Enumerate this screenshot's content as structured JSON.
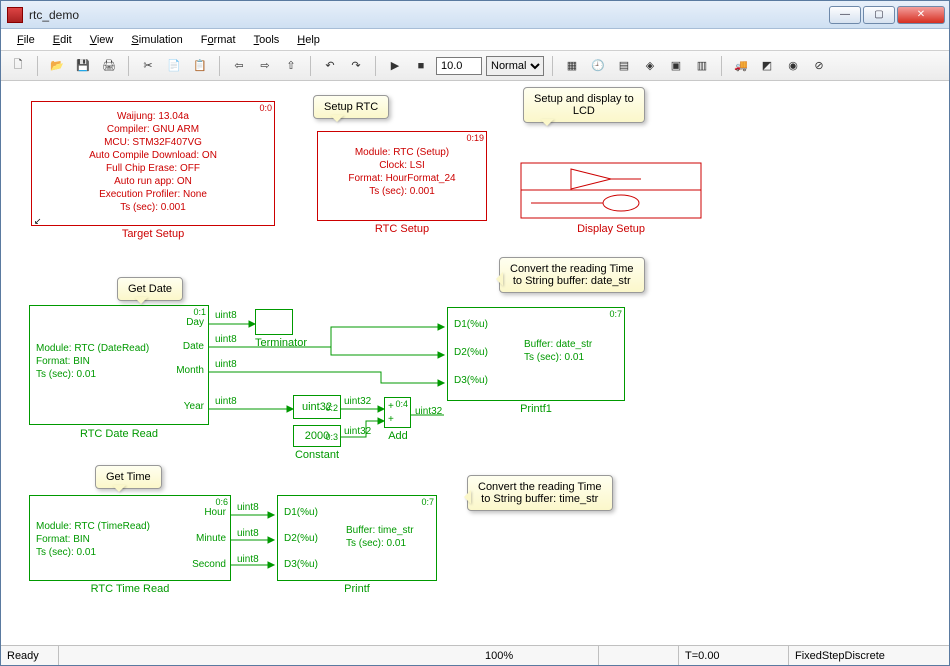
{
  "window": {
    "title": "rtc_demo"
  },
  "menu": {
    "file": "File",
    "edit": "Edit",
    "view": "View",
    "simulation": "Simulation",
    "format": "Format",
    "tools": "Tools",
    "help": "Help"
  },
  "toolbar": {
    "time": "10.0",
    "mode": "Normal",
    "icons": {
      "new": "🗋",
      "open": "📂",
      "save": "💾",
      "print": "🖨",
      "cut": "✂",
      "copy": "📄",
      "paste": "📋",
      "back": "⇦",
      "fwd": "⇨",
      "up": "⇧",
      "undo": "↶",
      "redo": "↷",
      "play": "▶",
      "stop": "■",
      "t1": "▦",
      "t2": "🕘",
      "t3": "▤",
      "t4": "◈",
      "t5": "▣",
      "t6": "▥",
      "t7": "🚚",
      "t8": "◩",
      "t9": "◉",
      "t10": "⊘"
    }
  },
  "status": {
    "ready": "Ready",
    "zoom": "100%",
    "t": "T=0.00",
    "solver": "FixedStepDiscrete",
    "blank": ""
  },
  "callouts": {
    "setup_rtc": "Setup RTC",
    "setup_lcd": "Setup and display to\nLCD",
    "get_date": "Get Date",
    "get_time": "Get Time",
    "conv_date": "Convert the reading Time\nto String buffer: date_str",
    "conv_time": "Convert the reading Time\nto String buffer: time_str"
  },
  "blocks": {
    "target": {
      "corner": "0:0",
      "lines": [
        "Waijung: 13.04a",
        "Compiler: GNU ARM",
        "MCU: STM32F407VG",
        "Auto Compile Download: ON",
        "Full Chip Erase: OFF",
        "Auto run app: ON",
        "Execution Profiler: None",
        "Ts (sec): 0.001"
      ],
      "label": "Target Setup"
    },
    "rtc_setup": {
      "corner": "0:19",
      "lines": [
        "Module: RTC (Setup)",
        "Clock: LSI",
        "Format: HourFormat_24",
        "Ts (sec): 0.001"
      ],
      "label": "RTC Setup"
    },
    "display_setup": {
      "label": "Display Setup"
    },
    "date_read": {
      "corner": "0:1",
      "lines": [
        "Module: RTC (DateRead)",
        "Format: BIN",
        "Ts (sec): 0.01"
      ],
      "ports": [
        "Day",
        "Date",
        "Month",
        "Year"
      ],
      "label": "RTC Date Read"
    },
    "time_read": {
      "corner": "0:6",
      "lines": [
        "Module: RTC (TimeRead)",
        "Format: BIN",
        "Ts (sec): 0.01"
      ],
      "ports": [
        "Hour",
        "Minute",
        "Second"
      ],
      "label": "RTC Time Read"
    },
    "terminator": {
      "label": "Terminator"
    },
    "uint32": {
      "corner": "0:2",
      "text": "uint32"
    },
    "constant": {
      "corner": "0:3",
      "text": "2000",
      "label": "Constant"
    },
    "add": {
      "corner": "0:4",
      "label": "Add",
      "ops": [
        "+",
        "+"
      ]
    },
    "printf1": {
      "corner": "0:7",
      "ports_in": [
        "D1(%u)",
        "D2(%u)",
        "D3(%u)"
      ],
      "lines": [
        "Buffer: date_str",
        "Ts (sec): 0.01"
      ],
      "label": "Printf1"
    },
    "printf": {
      "corner": "0:7",
      "ports_in": [
        "D1(%u)",
        "D2(%u)",
        "D3(%u)"
      ],
      "lines": [
        "Buffer: time_str",
        "Ts (sec): 0.01"
      ],
      "label": "Printf"
    }
  },
  "signal_types": {
    "u8": "uint8",
    "u32": "uint32"
  }
}
